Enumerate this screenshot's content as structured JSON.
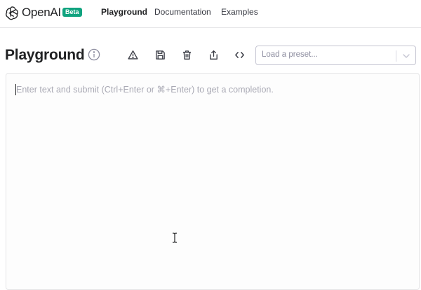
{
  "brand": {
    "name": "OpenAI",
    "badge": "Beta",
    "logo_icon": "openai-logo-icon",
    "accent_color": "#10a37f"
  },
  "nav": {
    "links": [
      {
        "label": "Playground",
        "active": true
      },
      {
        "label": "Documentation",
        "active": false
      },
      {
        "label": "Examples",
        "active": false
      }
    ]
  },
  "header": {
    "title": "Playground",
    "info_icon": "info-icon",
    "tools": [
      {
        "icon": "warning-icon",
        "action": "report"
      },
      {
        "icon": "save-icon",
        "action": "save"
      },
      {
        "icon": "trash-icon",
        "action": "delete"
      },
      {
        "icon": "share-icon",
        "action": "share"
      },
      {
        "icon": "code-icon",
        "action": "view-code"
      }
    ],
    "preset": {
      "placeholder": "Load a preset...",
      "chevron_icon": "chevron-down-icon"
    }
  },
  "editor": {
    "value": "",
    "placeholder": "Enter text and submit (Ctrl+Enter or ⌘+Enter) to get a completion."
  }
}
